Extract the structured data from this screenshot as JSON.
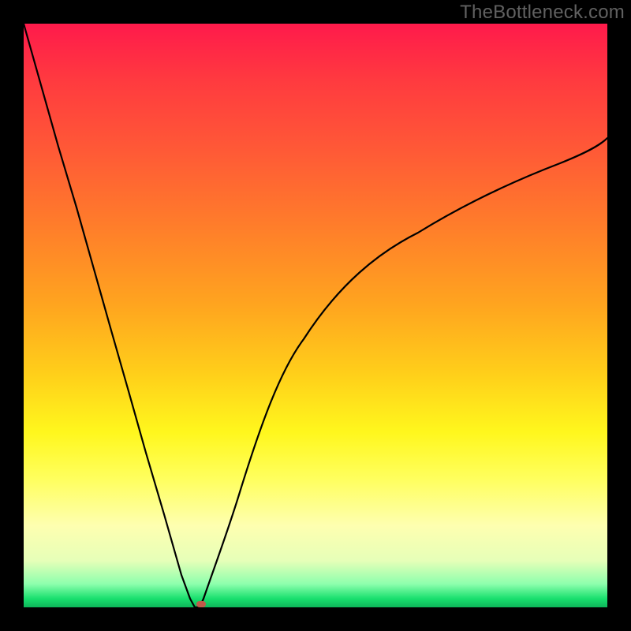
{
  "watermark": "TheBottleneck.com",
  "chart_data": {
    "type": "line",
    "title": "",
    "xlabel": "",
    "ylabel": "",
    "x": [
      0.0,
      0.03,
      0.06,
      0.09,
      0.12,
      0.15,
      0.18,
      0.21,
      0.24,
      0.27,
      0.285,
      0.294,
      0.3,
      0.308,
      0.33,
      0.37,
      0.42,
      0.48,
      0.55,
      0.63,
      0.72,
      0.82,
      0.92,
      1.0
    ],
    "values": [
      1.0,
      0.895,
      0.79,
      0.685,
      0.58,
      0.475,
      0.37,
      0.265,
      0.16,
      0.055,
      0.015,
      0.0,
      0.0,
      0.015,
      0.085,
      0.2,
      0.33,
      0.46,
      0.565,
      0.655,
      0.72,
      0.765,
      0.79,
      0.805
    ],
    "xlim": [
      0,
      1
    ],
    "ylim": [
      0,
      1
    ],
    "marker": {
      "x": 0.303,
      "y": 0.004
    },
    "gradient_stops": [
      {
        "pos": 0.0,
        "color": "#ff1a4b"
      },
      {
        "pos": 0.35,
        "color": "#ff7e2a"
      },
      {
        "pos": 0.7,
        "color": "#fff71d"
      },
      {
        "pos": 0.96,
        "color": "#8dffad"
      },
      {
        "pos": 1.0,
        "color": "#0db65a"
      }
    ]
  }
}
